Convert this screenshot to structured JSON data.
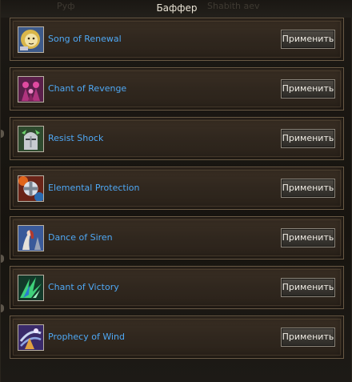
{
  "window": {
    "title": "Баффер",
    "background_text_left": "Руф",
    "background_text_right": "Shabith aev"
  },
  "skills": [
    {
      "name": "Song of Renewal",
      "icon": "lion-icon",
      "button_label": "Применить"
    },
    {
      "name": "Chant of Revenge",
      "icon": "dark-figures-icon",
      "button_label": "Применить"
    },
    {
      "name": "Resist Shock",
      "icon": "knight-helmet-icon",
      "button_label": "Применить"
    },
    {
      "name": "Elemental Protection",
      "icon": "elemental-cross-icon",
      "button_label": "Применить"
    },
    {
      "name": "Dance of Siren",
      "icon": "siren-icon",
      "button_label": "Применить"
    },
    {
      "name": "Chant of Victory",
      "icon": "green-wings-icon",
      "button_label": "Применить"
    },
    {
      "name": "Prophecy of Wind",
      "icon": "wind-icon",
      "button_label": "Применить"
    }
  ],
  "colors": {
    "skill_name": "#4fa8f4",
    "title": "#e8e2d4",
    "row_border": "#6a5a45"
  }
}
